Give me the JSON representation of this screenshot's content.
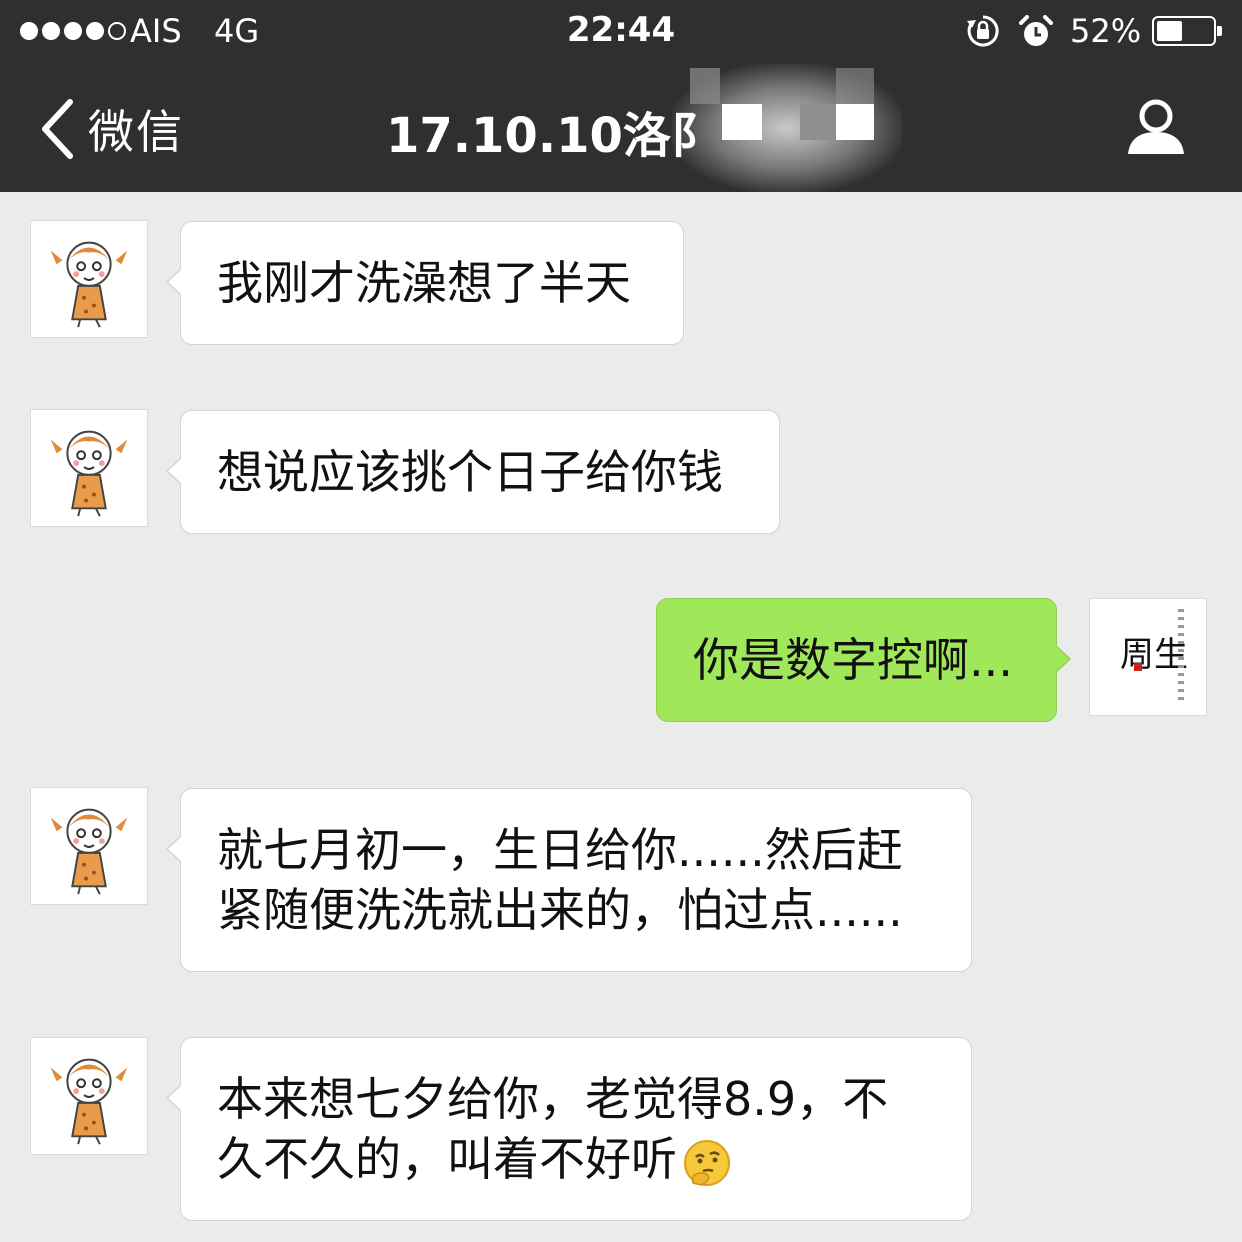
{
  "status_bar": {
    "carrier": "AIS",
    "network": "4G",
    "time": "22:44",
    "battery_percent": "52%",
    "battery_level": 0.52,
    "icons": [
      "signal-dots",
      "orientation-lock-icon",
      "alarm-icon",
      "battery-icon"
    ]
  },
  "nav": {
    "back_label": "微信",
    "title": "17.10.10洛阝",
    "right_icon": "person-icon"
  },
  "messages": [
    {
      "side": "left",
      "avatar": "cartoon-girl-avatar",
      "lines": [
        "我刚才洗澡想了半天"
      ]
    },
    {
      "side": "left",
      "avatar": "cartoon-girl-avatar",
      "lines": [
        "想说应该挑个日子给你钱"
      ]
    },
    {
      "side": "right",
      "avatar": "calligraphy-avatar",
      "avatar_text": "周生",
      "lines": [
        "你是数字控啊..."
      ]
    },
    {
      "side": "left",
      "avatar": "cartoon-girl-avatar",
      "lines": [
        "就七月初一，生日给你......然后赶",
        "紧随便洗洗就出来的，怕过点......"
      ]
    },
    {
      "side": "left",
      "avatar": "cartoon-girl-avatar",
      "lines": [
        "本来想七夕给你，老觉得8.9，不",
        "久不久的，叫着不好听"
      ],
      "emoji": "thinking-face-icon"
    }
  ],
  "colors": {
    "nav_bg": "#2f2f32",
    "chat_bg": "#ebebeb",
    "sent_bubble": "#a0e75a",
    "received_bubble": "#ffffff"
  }
}
